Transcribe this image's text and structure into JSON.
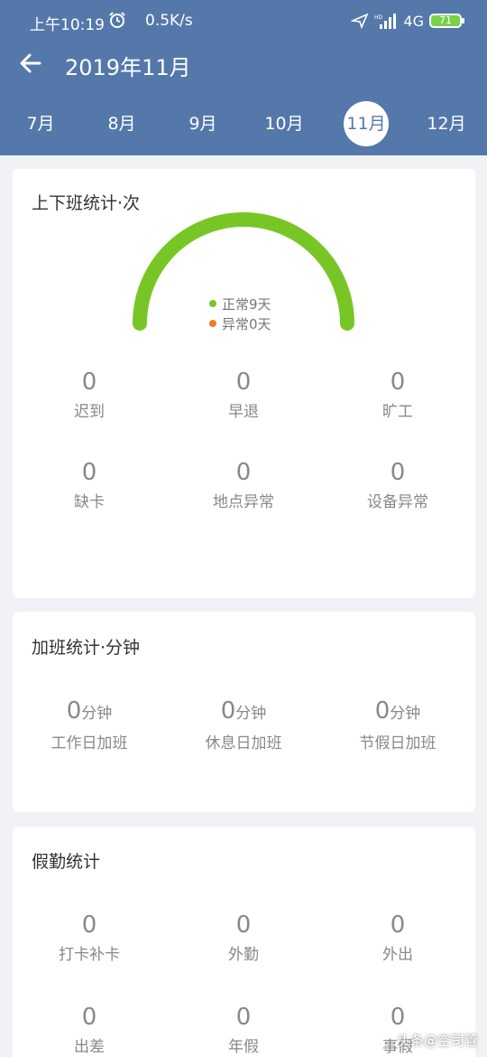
{
  "status_bar": {
    "time": "上午10:19",
    "net_speed": "0.5K/s",
    "net_type": "4G",
    "battery": "71"
  },
  "header": {
    "title": "2019年11月"
  },
  "months": [
    {
      "label": "7月",
      "active": false
    },
    {
      "label": "8月",
      "active": false
    },
    {
      "label": "9月",
      "active": false
    },
    {
      "label": "10月",
      "active": false
    },
    {
      "label": "11月",
      "active": true
    },
    {
      "label": "12月",
      "active": false
    }
  ],
  "attendance": {
    "title": "上下班统计·次",
    "legend": {
      "normal": "正常9天",
      "abnormal": "异常0天"
    },
    "colors": {
      "normal": "#78c626",
      "abnormal": "#f07a2a"
    },
    "stats": [
      {
        "value": "0",
        "label": "迟到"
      },
      {
        "value": "0",
        "label": "早退"
      },
      {
        "value": "0",
        "label": "旷工"
      },
      {
        "value": "0",
        "label": "缺卡"
      },
      {
        "value": "0",
        "label": "地点异常"
      },
      {
        "value": "0",
        "label": "设备异常"
      }
    ]
  },
  "overtime": {
    "title": "加班统计·分钟",
    "unit": "分钟",
    "stats": [
      {
        "value": "0",
        "label": "工作日加班"
      },
      {
        "value": "0",
        "label": "休息日加班"
      },
      {
        "value": "0",
        "label": "节假日加班"
      }
    ]
  },
  "leave": {
    "title": "假勤统计",
    "stats": [
      {
        "value": "0",
        "label": "打卡补卡"
      },
      {
        "value": "0",
        "label": "外勤"
      },
      {
        "value": "0",
        "label": "外出"
      },
      {
        "value": "0",
        "label": "出差"
      },
      {
        "value": "0",
        "label": "年假"
      },
      {
        "value": "0",
        "label": "事假"
      }
    ]
  },
  "watermark": "头条@空司管"
}
